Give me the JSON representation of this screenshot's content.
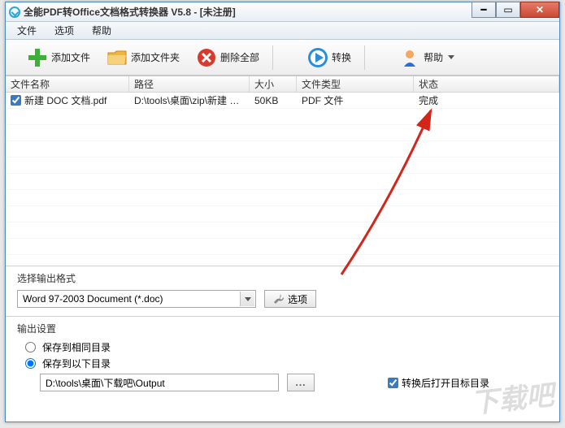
{
  "titlebar": {
    "text": "全能PDF转Office文档格式转换器 V5.8  -  [未注册]"
  },
  "menu": {
    "file": "文件",
    "options": "选项",
    "help": "帮助"
  },
  "toolbar": {
    "add_file": "添加文件",
    "add_folder": "添加文件夹",
    "delete_all": "删除全部",
    "convert": "转换",
    "help": "帮助"
  },
  "table": {
    "headers": {
      "name": "文件名称",
      "path": "路径",
      "size": "大小",
      "type": "文件类型",
      "status": "状态"
    },
    "rows": [
      {
        "checked": true,
        "name": "新建 DOC 文档.pdf",
        "path": "D:\\tools\\桌面\\zip\\新建 D...",
        "size": "50KB",
        "type": "PDF 文件",
        "status": "完成"
      }
    ]
  },
  "format_section": {
    "title": "选择输出格式",
    "selected": "Word 97-2003 Document (*.doc)",
    "options_btn": "选项"
  },
  "output_section": {
    "title": "输出设置",
    "same_dir": "保存到相同目录",
    "below_dir": "保存到以下目录",
    "path": "D:\\tools\\桌面\\下载吧\\Output",
    "browse": "...",
    "open_after": "转换后打开目标目录"
  },
  "watermark": "下载吧"
}
